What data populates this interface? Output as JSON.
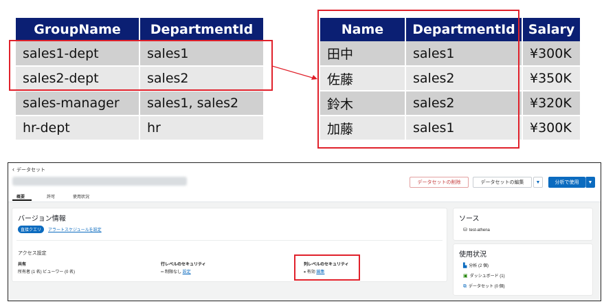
{
  "group_table": {
    "headers": [
      "GroupName",
      "DepartmentId"
    ],
    "rows": [
      [
        "sales1-dept",
        "sales1"
      ],
      [
        "sales2-dept",
        "sales2"
      ],
      [
        "sales-manager",
        "sales1, sales2"
      ],
      [
        "hr-dept",
        "hr"
      ]
    ]
  },
  "user_table": {
    "headers": [
      "Name",
      "DepartmentId",
      "Salary"
    ],
    "rows": [
      [
        "田中",
        "sales1",
        "¥300K"
      ],
      [
        "佐藤",
        "sales2",
        "¥350K"
      ],
      [
        "鈴木",
        "sales2",
        "¥320K"
      ],
      [
        "加藤",
        "sales1",
        "¥300K"
      ]
    ]
  },
  "colors": {
    "table_header": "#0b1f73",
    "highlight": "#e0202a",
    "primary_button": "#0b6bbf"
  },
  "dataset_page": {
    "breadcrumb": "データセット",
    "buttons": {
      "delete": "データセットの削除",
      "edit": "データセットの編集",
      "use": "分析で使用",
      "dropdown": "▼"
    },
    "tabs": [
      "概要",
      "許可",
      "使用状況"
    ],
    "version": {
      "title": "バージョン情報",
      "badge": "直接クエリ",
      "link": "アラートスケジュールを設定"
    },
    "access": {
      "title": "アクセス設定",
      "shared_label": "共有",
      "shared_value": "所有者 (1 名) ビューワー (0 名)",
      "row_security_label": "行レベルのセキュリティ",
      "row_security_value": "制限なし",
      "row_security_link": "設定",
      "col_security_label": "列レベルのセキュリティ",
      "col_security_value": "有効",
      "col_security_link": "編集"
    },
    "source": {
      "title": "ソース",
      "item": "test-athena"
    },
    "usage": {
      "title": "使用状況",
      "items": [
        "分析 (2 個)",
        "ダッシュボード (1)",
        "データセット (0 個)"
      ]
    }
  }
}
